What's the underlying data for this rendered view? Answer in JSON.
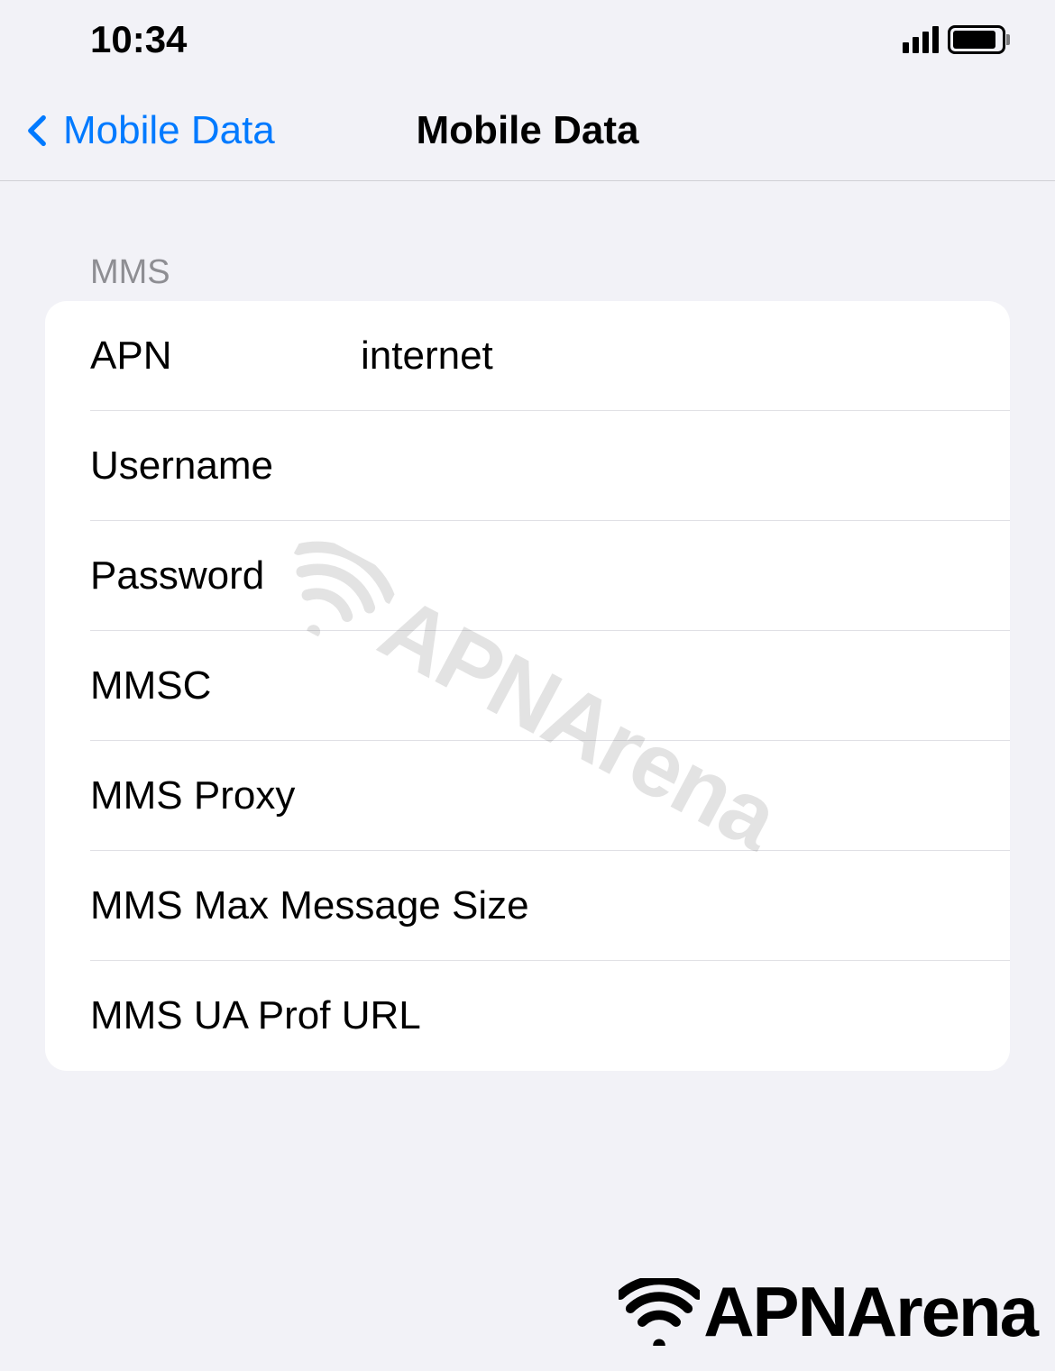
{
  "status_bar": {
    "time": "10:34"
  },
  "nav": {
    "back_label": "Mobile Data",
    "title": "Mobile Data"
  },
  "section_header": "MMS",
  "fields": {
    "apn": {
      "label": "APN",
      "value": "internet"
    },
    "username": {
      "label": "Username",
      "value": ""
    },
    "password": {
      "label": "Password",
      "value": ""
    },
    "mmsc": {
      "label": "MMSC",
      "value": ""
    },
    "mms_proxy": {
      "label": "MMS Proxy",
      "value": ""
    },
    "mms_max_size": {
      "label": "MMS Max Message Size",
      "value": ""
    },
    "mms_ua_prof": {
      "label": "MMS UA Prof URL",
      "value": ""
    }
  },
  "brand": "APNArena"
}
